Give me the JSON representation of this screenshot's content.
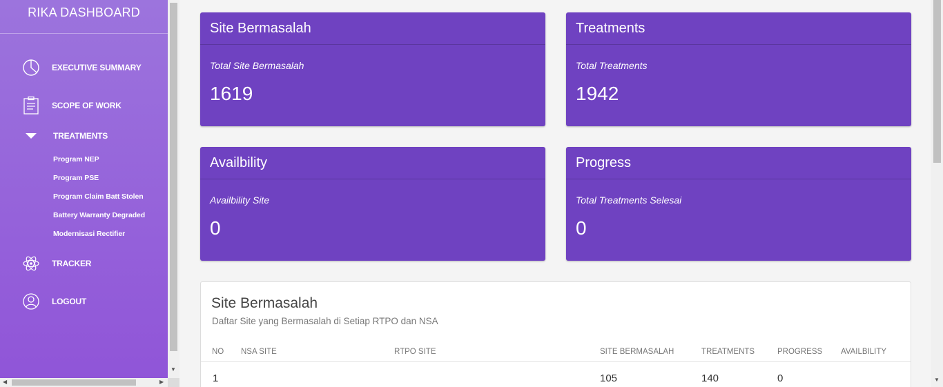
{
  "sidebar": {
    "brand": "RIKA DASHBOARD",
    "nav": [
      {
        "label": "EXECUTIVE SUMMARY",
        "icon": "pie-chart-icon"
      },
      {
        "label": "SCOPE OF WORK",
        "icon": "clipboard-icon"
      },
      {
        "label": "TREATMENTS",
        "icon": "caret-down-icon"
      },
      {
        "label": "TRACKER",
        "icon": "atom-icon"
      },
      {
        "label": "LOGOUT",
        "icon": "user-icon"
      }
    ],
    "treatments_sub": [
      "Program NEP",
      "Program PSE",
      "Program Claim Batt Stolen",
      "Battery Warranty Degraded",
      "Modernisasi Rectifier"
    ]
  },
  "cards": [
    {
      "title": "Site Bermasalah",
      "subtitle": "Total Site Bermasalah",
      "value": "1619"
    },
    {
      "title": "Treatments",
      "subtitle": "Total Treatments",
      "value": "1942"
    },
    {
      "title": "Availbility",
      "subtitle": "Availbility Site",
      "value": "0"
    },
    {
      "title": "Progress",
      "subtitle": "Total Treatments Selesai",
      "value": "0"
    }
  ],
  "table_panel": {
    "title": "Site Bermasalah",
    "subtitle": "Daftar Site yang Bermasalah di Setiap RTPO dan NSA",
    "columns": [
      "NO",
      "NSA SITE",
      "RTPO SITE",
      "SITE BERMASALAH",
      "TREATMENTS",
      "PROGRESS",
      "AVAILBILITY"
    ],
    "rows": [
      {
        "no": "1",
        "nsa_site": "",
        "rtpo_site": "",
        "site_bermasalah": "105",
        "treatments": "140",
        "progress": "0",
        "availbility": ""
      }
    ]
  },
  "colors": {
    "sidebar_gradient_top": "#9c74dd",
    "sidebar_gradient_bottom": "#9055d8",
    "card_background": "#6f42c1",
    "page_background": "#f4f4f4"
  }
}
